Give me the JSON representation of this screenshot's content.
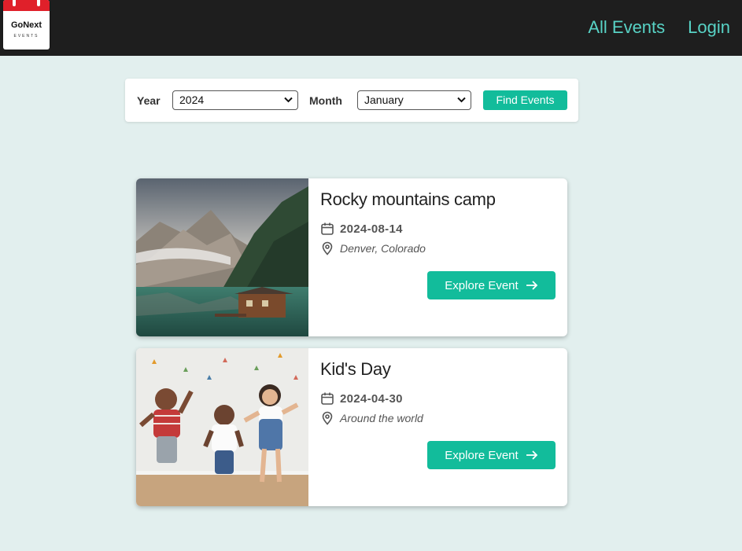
{
  "brand": {
    "name": "GoNext",
    "sub": "EVENTS"
  },
  "nav": {
    "all_events": "All Events",
    "login": "Login"
  },
  "filter": {
    "year_label": "Year",
    "year_value": "2024",
    "month_label": "Month",
    "month_value": "January",
    "find_button": "Find Events"
  },
  "events": [
    {
      "title": "Rocky mountains camp",
      "date": "2024-08-14",
      "location": "Denver, Colorado",
      "button": "Explore Event",
      "image": "mountain-lake-cabin-photo"
    },
    {
      "title": "Kid's Day",
      "date": "2024-04-30",
      "location": "Around the world",
      "button": "Explore Event",
      "image": "kids-dancing-photo"
    }
  ],
  "colors": {
    "accent": "#12bc9b",
    "nav_link": "#58d3c6",
    "header_bg": "#1e1e1e",
    "page_bg": "#e2efee"
  }
}
